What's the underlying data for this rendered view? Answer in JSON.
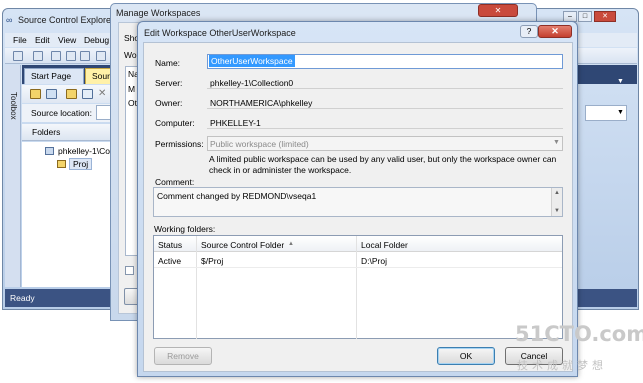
{
  "vs": {
    "title": "Source Control Explore",
    "menu": [
      "File",
      "Edit",
      "View",
      "Debug"
    ],
    "toolbox_label": "Toolbox",
    "tabs": [
      "Start Page",
      "Source"
    ],
    "source_location_label": "Source location:",
    "folders_header": "Folders",
    "tree": [
      "phkelley-1\\Collec",
      "Proj"
    ],
    "status": "Ready"
  },
  "manage": {
    "title": "Manage Workspaces",
    "fragments": [
      "Sho",
      "Wo",
      "Na",
      "M",
      "Ot"
    ]
  },
  "edit": {
    "title": "Edit Workspace OtherUserWorkspace",
    "help": "?",
    "close": "✕",
    "name_label": "Name:",
    "name_value": "OtherUserWorkspace",
    "server_label": "Server:",
    "server_value": "phkelley-1\\Collection0",
    "owner_label": "Owner:",
    "owner_value": "NORTHAMERICA\\phkelley",
    "computer_label": "Computer:",
    "computer_value": "PHKELLEY-1",
    "permissions_label": "Permissions:",
    "permissions_value": "Public workspace (limited)",
    "permissions_desc": "A limited public workspace can be used by any valid user, but only the workspace owner can check in or administer the workspace.",
    "comment_label": "Comment:",
    "comment_value": "Comment changed by REDMOND\\vseqa1",
    "working_folders_label": "Working folders:",
    "columns": [
      "Status",
      "Source Control Folder",
      "Local Folder"
    ],
    "rows": [
      {
        "status": "Active",
        "source": "$/Proj",
        "local": "D:\\Proj"
      }
    ],
    "remove_button": "Remove",
    "ok_button": "OK",
    "cancel_button": "Cancel"
  },
  "watermark": {
    "main": "51CTO.com",
    "sub": "技术成就梦想"
  },
  "colors": {
    "accent_selection": "#3399ff",
    "close_red": "#c4402f",
    "vs_dark_blue": "#2f4774"
  }
}
